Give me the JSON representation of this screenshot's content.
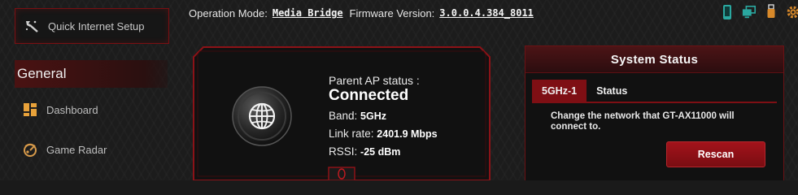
{
  "sidebar": {
    "quick_setup_label": "Quick Internet Setup",
    "section_title": "General",
    "items": [
      {
        "label": "Dashboard",
        "icon": "dashboard-icon"
      },
      {
        "label": "Game Radar",
        "icon": "game-radar-icon"
      }
    ]
  },
  "topbar": {
    "operation_mode_label": "Operation Mode:",
    "operation_mode_value": "Media Bridge",
    "firmware_label": "Firmware Version:",
    "firmware_value": "3.0.0.4.384_8011",
    "icons": [
      "mobile-app-icon",
      "network-clients-icon",
      "usb-icon",
      "settings-icon"
    ]
  },
  "parent_ap": {
    "status_label": "Parent AP status :",
    "status_value": "Connected",
    "band_label": "Band:",
    "band_value": "5GHz",
    "link_rate_label": "Link rate:",
    "link_rate_value": "2401.9 Mbps",
    "rssi_label": "RSSI:",
    "rssi_value": "-25 dBm"
  },
  "system_status": {
    "title": "System Status",
    "tabs": [
      "5GHz-1",
      "Status"
    ],
    "active_tab": "5GHz-1",
    "description": "Change the network that GT-AX11000 will connect to.",
    "rescan_label": "Rescan"
  },
  "colors": {
    "accent": "#7e0f14",
    "button": "#a3131b",
    "icon_teal": "#2aa8a0",
    "icon_orange": "#d8892a"
  }
}
